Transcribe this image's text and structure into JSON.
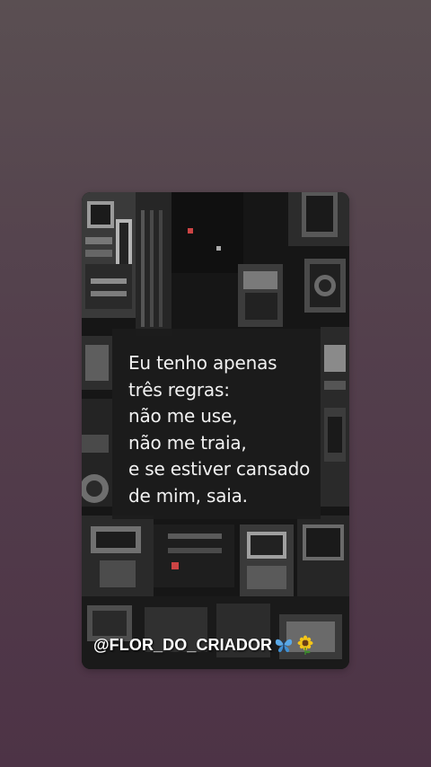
{
  "card": {
    "quote_lines": [
      "Eu tenho apenas",
      "três regras:",
      "não me use,",
      "não me traia,",
      "e se estiver cansado",
      "de mim, saia."
    ],
    "handle": "@FLOR_DO_CRIADOR",
    "handle_icons": [
      "butterfly-icon",
      "sunflower-icon"
    ]
  },
  "colors": {
    "background_top": "#5a4f52",
    "background_bottom": "#4d3346",
    "quote_box": "#1c1c1c",
    "quote_text": "#f1f1f1",
    "butterfly": "#5aa8e6",
    "sunflower_petals": "#f5c518"
  }
}
